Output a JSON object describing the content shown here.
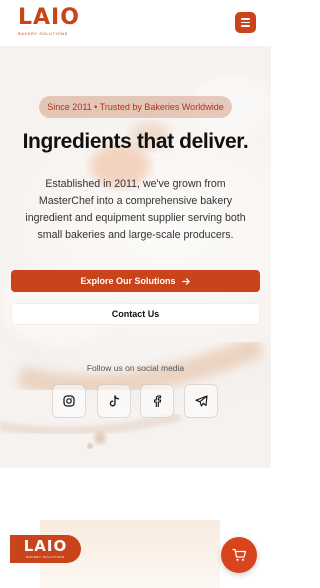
{
  "brand": {
    "logo_text": "LAIO",
    "logo_tagline": "BAKERY SOLUTIONS",
    "color": "#c9441a"
  },
  "header": {
    "menu_icon": "hamburger-menu-icon"
  },
  "hero": {
    "badge": "Since 2011 • Trusted by Bakeries Worldwide",
    "title": "Ingredients that deliver.",
    "description": "Established in 2011, we've grown from MasterChef into a comprehensive bakery ingredient and equipment supplier serving both small bakeries and large-scale producers.",
    "primary_button": "Explore Our Solutions",
    "primary_button_icon": "arrow-right-icon",
    "secondary_button": "Contact Us",
    "social_label": "Follow us on social media",
    "social_icons": [
      "instagram-icon",
      "tiktok-icon",
      "facebook-icon",
      "telegram-icon"
    ]
  },
  "footer_preview": {
    "logo_text": "LAIO",
    "logo_tagline": "BAKERY SOLUTIONS",
    "cart_icon": "shopping-cart-icon"
  }
}
